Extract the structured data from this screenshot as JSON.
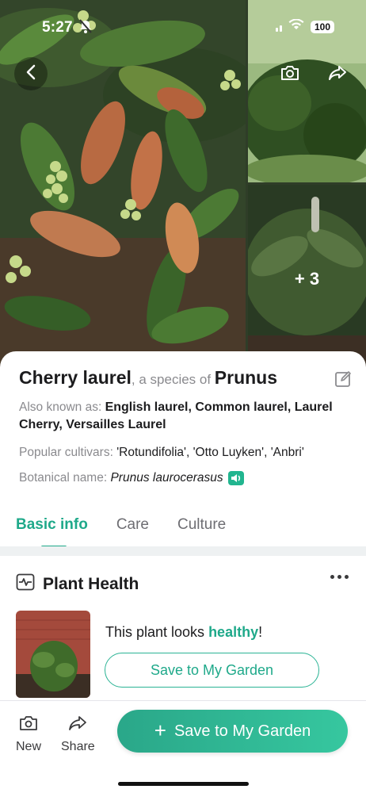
{
  "status_bar": {
    "time": "5:27",
    "battery": "100"
  },
  "gallery": {
    "more_count": "+ 3"
  },
  "plant": {
    "common_name": "Cherry laurel",
    "species_connector": ", a species of ",
    "genus": "Prunus",
    "also_known_label": "Also known as: ",
    "also_known_values": "English laurel, Common laurel, Laurel Cherry, Versailles Laurel",
    "cultivars_label": "Popular cultivars: ",
    "cultivars_values": "'Rotundifolia', 'Otto Luyken', 'Anbri'",
    "botanical_label": "Botanical name: ",
    "botanical_value": "Prunus laurocerasus"
  },
  "tabs": [
    {
      "label": "Basic info",
      "active": true
    },
    {
      "label": "Care",
      "active": false
    },
    {
      "label": "Culture",
      "active": false
    }
  ],
  "health": {
    "title": "Plant Health",
    "status_prefix": "This plant looks ",
    "status_value": "healthy",
    "status_suffix": "!",
    "save_button": "Save to My Garden"
  },
  "bottom_bar": {
    "new_label": "New",
    "share_label": "Share",
    "primary_label": "Save to My Garden",
    "primary_icon": "+"
  },
  "colors": {
    "accent": "#1fa98a",
    "accent_light": "#36c79f"
  },
  "icons": [
    "bell-slash-icon",
    "signal-icon",
    "wifi-icon",
    "back-chevron-icon",
    "camera-icon",
    "share-icon",
    "edit-icon",
    "speaker-icon",
    "pulse-icon",
    "more-dots-icon"
  ]
}
